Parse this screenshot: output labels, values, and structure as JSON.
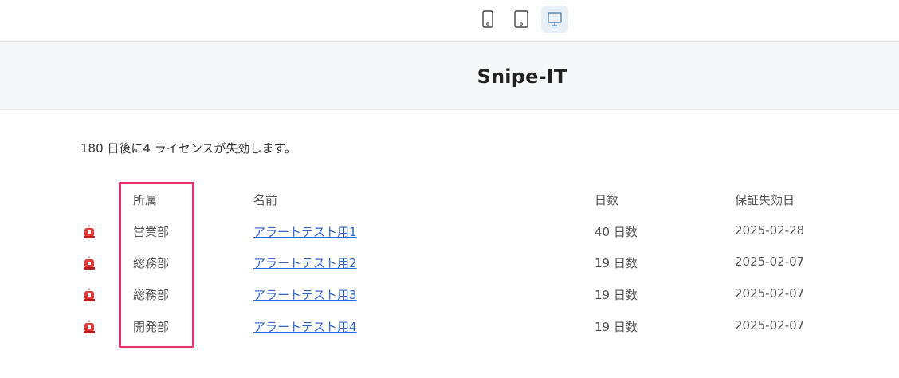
{
  "toolbar": {
    "devices": [
      {
        "name": "mobile",
        "icon": "mobile-icon"
      },
      {
        "name": "tablet",
        "icon": "tablet-icon"
      },
      {
        "name": "desktop",
        "icon": "desktop-icon",
        "selected": true
      }
    ],
    "selected_color": "#e8f1f8"
  },
  "email": {
    "title": "Snipe-IT",
    "intro": "180 日後に4 ライセンスが失効します。"
  },
  "table": {
    "headers": [
      "所属",
      "名前",
      "日数",
      "保証失効日"
    ],
    "rows": [
      {
        "department": "営業部",
        "name": "アラートテスト用1",
        "days": "40 日数",
        "expiry": "2025-02-28",
        "icon": "siren-icon"
      },
      {
        "department": "総務部",
        "name": "アラートテスト用2",
        "days": "19 日数",
        "expiry": "2025-02-07",
        "icon": "siren-icon"
      },
      {
        "department": "総務部",
        "name": "アラートテスト用3",
        "days": "19 日数",
        "expiry": "2025-02-07",
        "icon": "siren-icon"
      },
      {
        "department": "開発部",
        "name": "アラートテスト用4",
        "days": "19 日数",
        "expiry": "2025-02-07",
        "icon": "siren-icon"
      }
    ]
  },
  "colors": {
    "link": "#3366cc",
    "highlight": "#e8336d",
    "header_bg": "#f6f7f8"
  }
}
